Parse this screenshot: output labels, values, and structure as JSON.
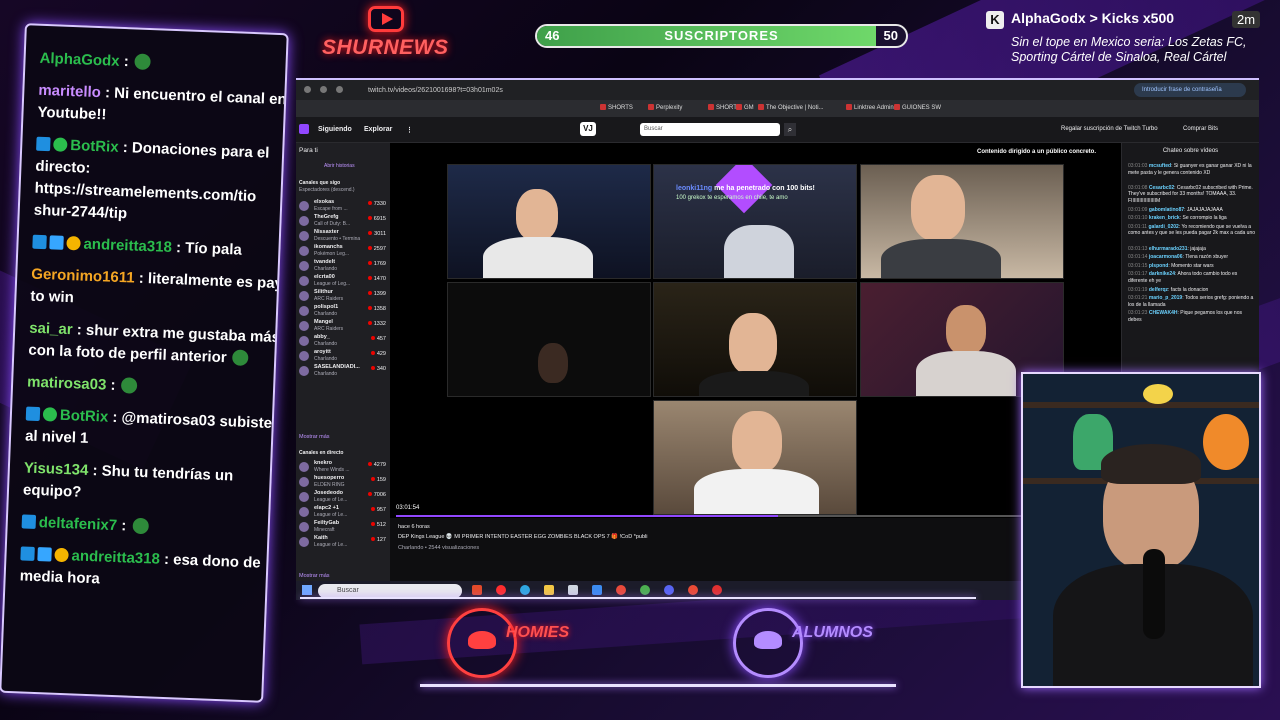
{
  "header": {
    "logo_text": "SHURNEWS",
    "subs_current": "46",
    "subs_label": "SUSCRIPTORES",
    "subs_goal": "50",
    "subs_progress": 0.92,
    "alert_user": "AlphaGodx",
    "alert_arrow": ">",
    "alert_event": "Kicks x500",
    "alert_time": "2m",
    "alert_message": "Sin el tope en Mexico seria: Los Zetas FC, Sporting Cártel de Sinaloa, Real Cártel"
  },
  "stream_chat": [
    {
      "user": "AlphaGodx",
      "color": "#2bbd4d",
      "text": ":",
      "badges": [],
      "emote": true
    },
    {
      "user": "maritello",
      "color": "#c98cff",
      "text": ": Ni encuentro el canal en Youtube!!",
      "badges": []
    },
    {
      "user": "BotRix",
      "color": "#2bbd4d",
      "text": ": Donaciones para el directo: https://streamelements.com/tio shur-2744/tip",
      "badges": [
        "b-ar",
        "b-ch"
      ]
    },
    {
      "user": "andreitta318",
      "color": "#2bbd4d",
      "text": ": Tío pala",
      "badges": [
        "b-ar",
        "b-cube",
        "b-one"
      ]
    },
    {
      "user": "Geronimo1611",
      "color": "#f5a623",
      "text": ": literalmente es pay to win",
      "badges": []
    },
    {
      "user": "sai_ar",
      "color": "#7fe36b",
      "text": ": shur extra me gustaba más con la foto de perfil anterior",
      "badges": [],
      "emote": true
    },
    {
      "user": "matirosa03",
      "color": "#7fe36b",
      "text": ":",
      "badges": [],
      "emote": true
    },
    {
      "user": "BotRix",
      "color": "#2bbd4d",
      "text": ": @matirosa03 subiste al nivel 1",
      "badges": [
        "b-ar",
        "b-ch"
      ]
    },
    {
      "user": "Yisus134",
      "color": "#7fe36b",
      "text": ": Shu tu tendrías un equipo?",
      "badges": []
    },
    {
      "user": "deltafenix7",
      "color": "#2bbd4d",
      "text": ":",
      "badges": [
        "b-ar"
      ],
      "emote": true
    },
    {
      "user": "andreitta318",
      "color": "#2bbd4d",
      "text": ": esa dono de media hora",
      "badges": [
        "b-ar",
        "b-cube",
        "b-one"
      ]
    }
  ],
  "browser": {
    "url": "twitch.tv/videos/2621001698?t=03h01m02s",
    "passkey_label": "Introducir frase de contraseña",
    "bookmarks": [
      "SHORTS",
      "Perplexity",
      "SHORTS",
      "GM",
      "The Objective | Noti...",
      "Linktree Admin",
      "GUIONES SW"
    ],
    "nav": {
      "following": "Siguiendo",
      "browse": "Explorar",
      "more": "⋮",
      "search_placeholder": "Buscar",
      "turbo": "Regalar suscripción de Twitch Turbo",
      "bits": "Comprar Bits"
    },
    "sidebar": {
      "for_you": "Para ti",
      "history": "Abrir historias",
      "followed_title": "Canales que sigo",
      "followed_sub": "Espectadores (descend.)",
      "followed": [
        {
          "name": "elxokas",
          "game": "Escape from ...",
          "viewers": "7330"
        },
        {
          "name": "TheGrefg",
          "game": "Call of Duty: B...",
          "viewers": "6915"
        },
        {
          "name": "Nissaxter",
          "game": "Descuento • Termina",
          "viewers": "3011"
        },
        {
          "name": "ikomanchs",
          "game": "Pokémon Leg...",
          "viewers": "2597"
        },
        {
          "name": "tvandelt",
          "game": "Charlando",
          "viewers": "1769"
        },
        {
          "name": "elcrta00",
          "game": "League of Leg...",
          "viewers": "1470"
        },
        {
          "name": "Silithur",
          "game": "ARC Raiders",
          "viewers": "1399"
        },
        {
          "name": "polispol1",
          "game": "Charlando",
          "viewers": "1358"
        },
        {
          "name": "Mangel",
          "game": "ARC Raiders",
          "viewers": "1332"
        },
        {
          "name": "abby_",
          "game": "Charlando",
          "viewers": "457"
        },
        {
          "name": "aroyitt",
          "game": "Charlando",
          "viewers": "429"
        },
        {
          "name": "SASELANDIADI...",
          "game": "Charlando",
          "viewers": "340"
        }
      ],
      "show_more": "Mostrar más",
      "live_title": "Canales en directo",
      "live": [
        {
          "name": "knekro",
          "game": "Where Winds ...",
          "viewers": "4279"
        },
        {
          "name": "huesoperro",
          "game": "ELDEN RING",
          "viewers": "159"
        },
        {
          "name": "Josedeodo",
          "game": "League of Le...",
          "viewers": "7006"
        },
        {
          "name": "elapc2 +1",
          "game": "League of Le...",
          "viewers": "957"
        },
        {
          "name": "FeiltyGab",
          "game": "Minecraft",
          "viewers": "512"
        },
        {
          "name": "Kaith",
          "game": "League of Le...",
          "viewers": "127"
        }
      ],
      "show_more_2": "Mostrar más"
    },
    "player": {
      "content_notice": "Contenido dirigido a un público concreto.",
      "overlay_user": "leonki11ng",
      "overlay_text": "me ha penetrado con 100 bits!",
      "overlay_sub": "100 grekox te esperamos en chile, te amo",
      "time": "03:01:54",
      "progress": 0.53
    },
    "video_info": {
      "ago": "hace 6 horas",
      "title": "DEP Kings League 💀 MI PRIMER INTENTO EASTER EGG ZOMBIES BLACK OPS 7 🎁 !CoD *publi",
      "meta": "Charlando • 2544 visualizaciones"
    },
    "right_chat": {
      "title": "Chateo sobre vídeos",
      "lines": [
        {
          "t": "03:01:03",
          "user": "mcsufted",
          "text": ": Si guanyer es ganar ganar XD ni la mete pasta y le genera contenido XD"
        },
        {
          "t": "03:01:08",
          "user": "Cesarbc02",
          "text": ": Cesarbc02 subscribed with Prime. They've subscribed for 33 months! TOMAAA, 33. FIIIIIIIIIIIIIIIIIIM"
        },
        {
          "t": "03:01:09",
          "user": "gabomlatino87",
          "text": ": JAJAJAJAJAAA"
        },
        {
          "t": "03:01:10",
          "user": "kraken_brick",
          "text": ": Se corrompio la liga"
        },
        {
          "t": "03:01:11",
          "user": "galardi_0202",
          "text": ": Yo recomiendo que se vuelva a como antes y que se les pueda pagar 2k max a cada uno"
        },
        {
          "t": "03:01:13",
          "user": "elhurmarado231",
          "text": ": jajajaja"
        },
        {
          "t": "03:01:14",
          "user": "joacarmona06",
          "text": ": Tlena razón xbuyer"
        },
        {
          "t": "03:01:15",
          "user": "plspond",
          "text": ": Momento star wars"
        },
        {
          "t": "03:01:17",
          "user": "darknike24",
          "text": ": Ahora todo cambio todo es diferente eh ye"
        },
        {
          "t": "03:01:19",
          "user": "delferqz",
          "text": ": facts la donacion"
        },
        {
          "t": "03:01:21",
          "user": "mario_p_2019",
          "text": ": Todos serios grefg: poniendo a los de la llamada"
        },
        {
          "t": "03:01:23",
          "user": "CHEWAK4H",
          "text": ": Pique pegamos los que nos debes"
        }
      ]
    },
    "taskbar": {
      "search": "Buscar"
    }
  },
  "bottom": {
    "homies": "HOMIES",
    "alumnos": "ALUMNOS"
  }
}
